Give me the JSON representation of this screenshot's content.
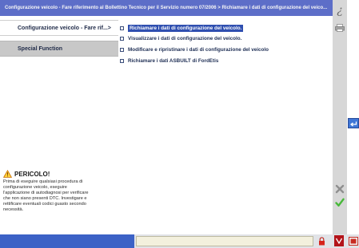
{
  "title_bar": {
    "text": "Configurazione veicolo - Fare riferimento al Bollettino Tecnico per il Servizio numero 07/2006 > Richiamare i dati di configurazione del veico..."
  },
  "nav": {
    "tabs": [
      {
        "label": "Configurazione veicolo - Fare rif...>",
        "active": true
      },
      {
        "label": "Special Function",
        "active": false
      }
    ]
  },
  "menu": {
    "items": [
      {
        "label": "Richiamare i dati di configurazione del veicolo.",
        "selected": true
      },
      {
        "label": "Visualizzare i dati di configurazione del veicolo.",
        "selected": false
      },
      {
        "label": "Modificare e ripristinare i dati di configurazione del veicolo",
        "selected": false
      },
      {
        "label": "Richiamare i dati ASBUILT di FordEtis",
        "selected": false
      }
    ]
  },
  "warning": {
    "heading": "PERICOLO!",
    "body": "Prima di eseguire qualsiasi procedura di\nconfigurazione veicolo, eseguire\nl'applicazione di autodiagnosi per verificare\nche non siano presenti DTC. Investigare e\nrettificare eventuali codici guasto secondo\nnecessità."
  },
  "icons": {
    "help": "help-icon",
    "print": "print-icon",
    "back": "back-arrow-icon",
    "cancel": "cancel-x-icon",
    "confirm": "checkmark-icon",
    "lock": "lock-icon",
    "connection": "connection-status-icon",
    "window": "window-icon"
  },
  "colors": {
    "title_bar": "#5d6ec8",
    "selection": "#2f4fb0",
    "status_blue": "#3c62c6",
    "confirm_green": "#48b93a",
    "cancel_gray": "#8f8f8f"
  }
}
